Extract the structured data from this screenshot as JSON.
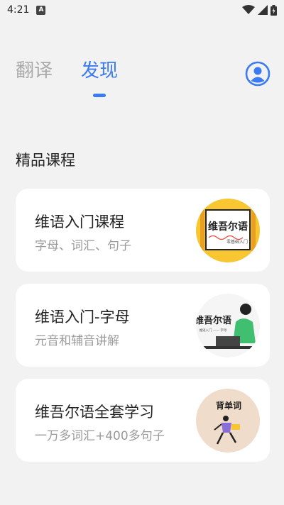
{
  "status_bar": {
    "time": "4:21",
    "notification_badge": "A"
  },
  "tabs": [
    {
      "label": "翻译",
      "active": false
    },
    {
      "label": "发现",
      "active": true
    }
  ],
  "section": {
    "title": "精品课程"
  },
  "courses": [
    {
      "title": "维语入门课程",
      "subtitle": "字母、词汇、句子",
      "thumb_title": "维吾尔语",
      "thumb_caption": "零基础入门"
    },
    {
      "title": "维语入门-字母",
      "subtitle": "元音和辅音讲解",
      "thumb_title": "维吾尔语",
      "thumb_caption": "维语入门 —— 字母"
    },
    {
      "title": "维吾尔语全套学习",
      "subtitle": "一万多词汇+400多句子",
      "thumb_title": "背单词"
    }
  ],
  "colors": {
    "accent": "#3a7bf2",
    "background": "#f2f2f2",
    "card": "#ffffff",
    "thumb_yellow": "#f7c631",
    "thumb_pink": "#f0dccb"
  }
}
